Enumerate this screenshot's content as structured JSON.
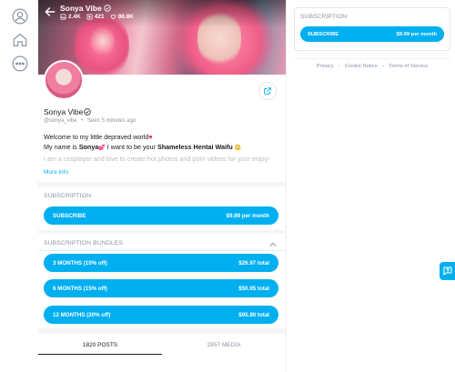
{
  "nav": {
    "icons": [
      "user-icon",
      "home-icon",
      "more-icon"
    ]
  },
  "header": {
    "name": "Sonya Vibe",
    "photos_count": "2.4K",
    "videos_count": "421",
    "likes_count": "98.8K"
  },
  "profile": {
    "name": "Sonya Vibe",
    "handle": "@sonya_vibe",
    "separator": "•",
    "seen": "Seen 5 minutes ago",
    "bio_line1": "Welcome to my little depraved world",
    "bio_line1_emoji": "♥",
    "bio_line2_pre": "My name is ",
    "bio_line2_name": "Sonya",
    "bio_line2_emoji": "💕",
    "bio_line2_mid": " I want to be your ",
    "bio_line2_bold": "Shameless Hentai Waifu",
    "bio_line2_emoji2": "😳",
    "bio_line3": "I am a cosplayer and love to create hot photos and porn videos for your enjoy-",
    "more_info": "More info"
  },
  "subscription": {
    "label": "SUBSCRIPTION",
    "button_label": "SUBSCRIBE",
    "button_price": "$9.99 per month"
  },
  "bundles": {
    "label": "SUBSCRIPTION BUNDLES",
    "items": [
      {
        "label": "3 MONTHS (10% off)",
        "price": "$26.97 total"
      },
      {
        "label": "6 MONTHS (15% off)",
        "price": "$50.95 total"
      },
      {
        "label": "12 MONTHS (20% off)",
        "price": "$95.90 total"
      }
    ]
  },
  "tabs": {
    "posts": "1820 POSTS",
    "media": "2857 MEDIA"
  },
  "sidebar": {
    "label": "SUBSCRIPTION",
    "button_label": "SUBSCRIBE",
    "button_price": "$9.99 per month",
    "links": [
      "Privacy",
      "Cookie Notice",
      "Terms of Service"
    ],
    "dot": "•"
  },
  "colors": {
    "accent": "#00aff0",
    "muted": "#8a96a3"
  }
}
